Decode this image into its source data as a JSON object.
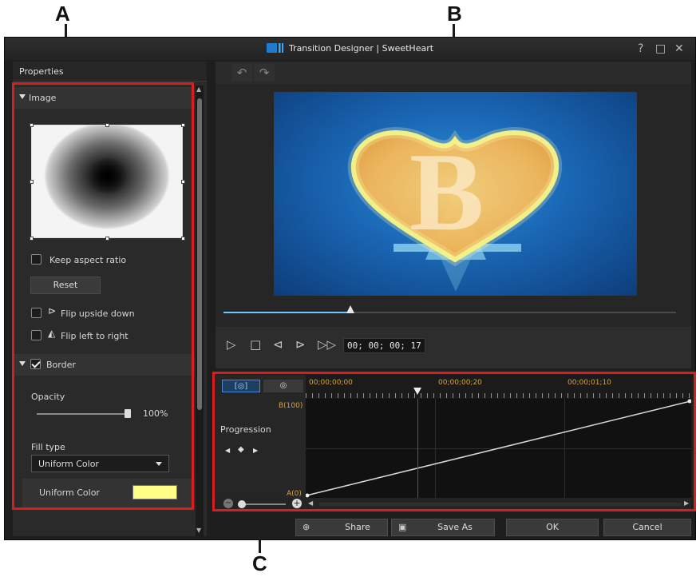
{
  "callouts": {
    "a": "A",
    "b": "B",
    "c": "C"
  },
  "window": {
    "title": "Transition Designer  |  SweetHeart",
    "controls": {
      "help": "?",
      "maximize": "□",
      "close": "✕"
    }
  },
  "properties": {
    "tab_label": "Properties",
    "image_section": {
      "header": "Image",
      "keep_aspect_label": "Keep aspect ratio",
      "reset_label": "Reset",
      "flip_upside_label": "Flip upside down",
      "flip_left_label": "Flip left to right"
    },
    "border_section": {
      "header": "Border",
      "checked": true,
      "opacity_label": "Opacity",
      "opacity_value": "100%",
      "opacity_level": 1.0,
      "fill_type_label": "Fill type",
      "fill_type_value": "Uniform Color",
      "uniform_color_label": "Uniform Color",
      "uniform_color": "#ffff88"
    }
  },
  "preview": {
    "undo_icon": "undo-icon",
    "redo_icon": "redo-icon",
    "seek_progress": 0.28,
    "timecode": "00; 00; 00; 17"
  },
  "timeline": {
    "tabs": [
      "[◎]",
      "◎"
    ],
    "timecodes": [
      "00;00;00;00",
      "00;00;00;20",
      "00;00;01;10"
    ],
    "track_label": "Progression",
    "y_top": "B(100)",
    "y_bottom": "A(0)",
    "playhead_fraction": 0.29
  },
  "footer": {
    "share_label": "Share",
    "save_as_label": "Save As",
    "ok_label": "OK",
    "cancel_label": "Cancel"
  },
  "colors": {
    "highlight": "#d81e1e",
    "timecode": "#d9a23e",
    "accent": "#6fc3ff"
  }
}
